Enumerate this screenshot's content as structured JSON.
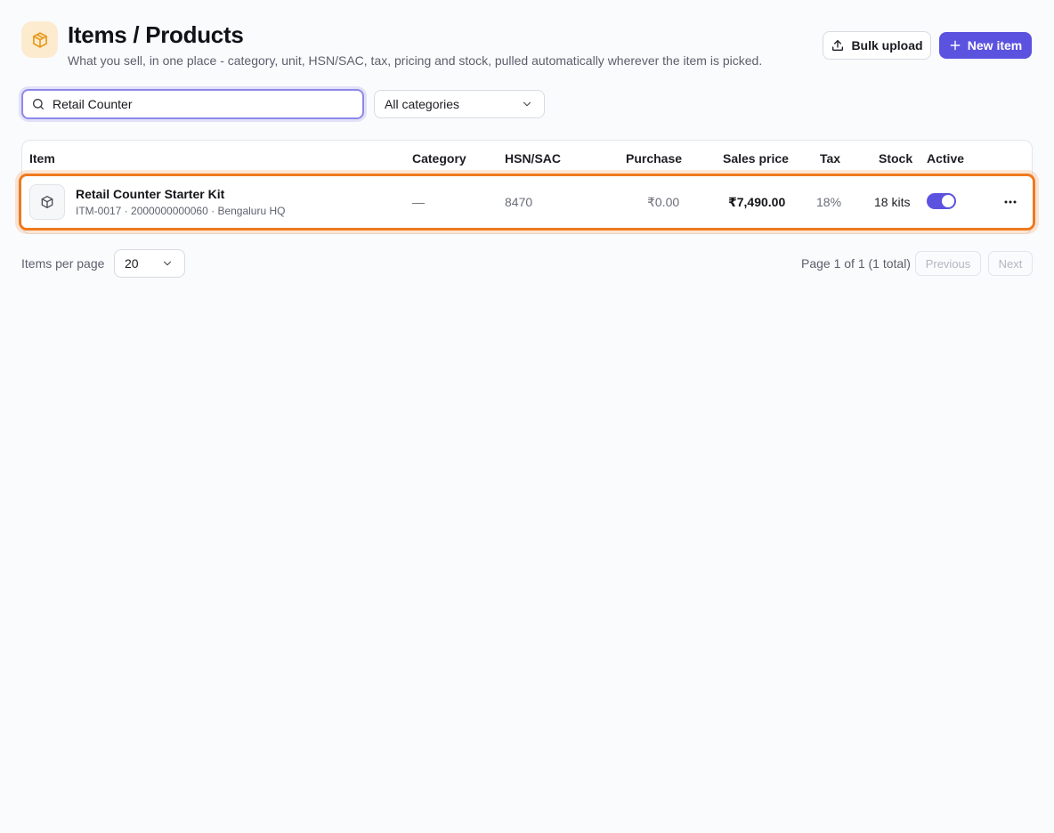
{
  "header": {
    "title": "Items / Products",
    "subtitle": "What you sell, in one place - category, unit, HSN/SAC, tax, pricing and stock, pulled automatically wherever the item is picked.",
    "icon": "box-icon",
    "bulk_upload_label": "Bulk upload",
    "new_item_label": "New item",
    "accent_color": "#5b52e0"
  },
  "filters": {
    "search_value": "Retail Counter",
    "category_selected": "All categories"
  },
  "table": {
    "columns": [
      "Item",
      "Category",
      "HSN/SAC",
      "Purchase",
      "Sales price",
      "Tax",
      "Stock",
      "Active"
    ],
    "rows": [
      {
        "name": "Retail Counter Starter Kit",
        "meta": "ITM-0017 · 2000000000060 · Bengaluru HQ",
        "category": "—",
        "hsn": "8470",
        "purchase": "₹0.00",
        "sales_price": "₹7,490.00",
        "tax": "18%",
        "stock": "18 kits",
        "active": true
      }
    ]
  },
  "pagination": {
    "per_page_label": "Items per page",
    "per_page_value": "20",
    "page_info": "Page 1 of 1 (1 total)",
    "previous_label": "Previous",
    "next_label": "Next"
  }
}
